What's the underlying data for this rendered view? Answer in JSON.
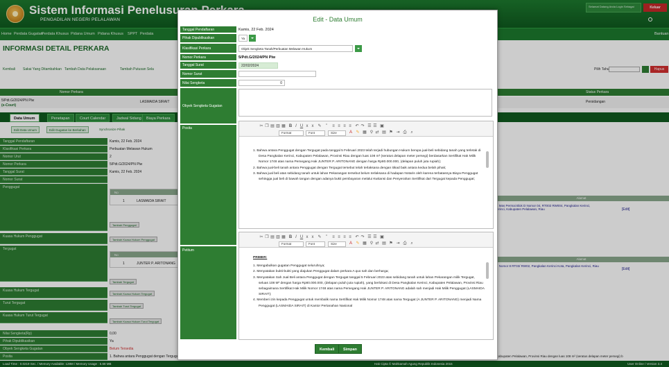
{
  "header": {
    "app_title": "Sistem Informasi Penelusuran Perkara",
    "app_subtitle": "PENGADILAN NEGERI PELALAWAN",
    "user_box": "Selamat Datang\nAnda Login Sebagai",
    "keluar": "Keluar",
    "bantuan": "Bantuan"
  },
  "nav": [
    "Home",
    "Perdata Gugatan",
    "Perdata Khusus",
    "Pidana Umum",
    "Pidana Khusus",
    "SPPT",
    "Perdata"
  ],
  "page": {
    "title": "INFORMASI DETAIL PERKARA",
    "toolbar": [
      "Kembali",
      "Sakai Yang Ditambahkan",
      "Tambah Data Pelaksanaan",
      "Tambah Putusan Sela"
    ],
    "pilih_tahun": "Pilih Tahun",
    "hapus": "Hapus",
    "grid_headers": [
      "Nomor Perkara",
      "Status Perkara"
    ],
    "grid_row": {
      "nomor": "5/Pdt.G/2024/PN Plw",
      "court": "(e-Court)",
      "pihak": "LASMAIDA SIRAIT",
      "status": "Persidangan"
    },
    "tabs": [
      "Data Umum",
      "Penetapan",
      "Court Calendar",
      "Jadwal Sidang",
      "Biaya Perkara"
    ],
    "sub_buttons": [
      "Edit Data Umum",
      "Edit Gugatan ke Berkahan",
      "Synchronize Pihak"
    ],
    "details": [
      {
        "label": "Tanggal Pendaftaran",
        "value": "Kamis, 22 Feb. 2024"
      },
      {
        "label": "Klasifikasi Perkara",
        "value": "Perbuatan Melawan Hukum"
      },
      {
        "label": "Nomor Urut",
        "value": "2"
      },
      {
        "label": "Nomor Perkara",
        "value": "5/Pdt.G/2024/PN Plw"
      },
      {
        "label": "Tanggal Surat",
        "value": "Kamis, 22 Feb. 2024"
      },
      {
        "label": "Nomor Surat",
        "value": ""
      },
      {
        "label": "Penggugat",
        "value": ""
      }
    ],
    "penggugat_row": {
      "no": "No",
      "idx": "1",
      "name": "LASMAIDA SIRAIT"
    },
    "tambah_penggugat": "Tambah Penggugat",
    "kuasa_hukum_penggugat": "Kuasa Hukum Penggugat",
    "tambah_kuasa_penggugat": "Tambah Kuasa Hukum Penggugat",
    "tergugat_label": "Tergugat",
    "tergugat_row": {
      "no": "No",
      "idx": "1",
      "name": "JUNTER P. ARITONANG"
    },
    "tambah_tergugat": "Tambah Tergugat",
    "kuasa_hukum_tergugat": "Kuasa Hukum Tergugat",
    "tambah_kuasa_tergugat": "Tambah Kuasa Hukum Tergugat",
    "turut_tergugat": "Turut Tergugat",
    "tambah_turut_tergugat": "Tambah Turut Tergugat",
    "kuasa_turut_tergugat": "Kuasa Hukum Turut Tergugat",
    "tambah_kuasa_turut": "Tambah Kuasa Hukum Turut Tergugat",
    "nilai_sengketa_label": "Nilai Sengketa(Rp)",
    "nilai_sengketa_value": "0,00",
    "pihak_dipublikasikan_label": "Pihak Dipublikasikan",
    "pihak_dipublikasikan_value": "Ya",
    "objek_sengketa_label": "Obyek Sengketa Gugatan",
    "objek_sengketa_value": "Belum Tersedia",
    "posita_label": "Posita",
    "posita_value": "1. Bahwa antara Penggugat dengan Tergugat pada tanggal 5 Februari 2023",
    "alamat_header": "Alamat",
    "alamat_penggugat": "Jl. Mas Permai Blok D Nomor 04, RT002 RW004, Pangkalan Kerinci, Kerinci, Kabupaten Pelalawan, Riau",
    "alamat_tergugat": "Jl. Nomor 8 RT03/ RW02, Pangkalan Kerinci Kota, Pangkalan Kerinci, Riau",
    "edit": "[Edit]",
    "bottom_text": "Kabupaten Pelalawan, Provinsi Riau dengan luas 108 m² (seratus delapan meter persegi) b"
  },
  "footer": {
    "left": "Load Time : 0.0219 Sec. / Memory Available: 128M / Memory Usage : 5.68 MB",
    "center": "Hak Cipta © Mahkamah Agung Republik Indonesia 2015",
    "right": "User Online / Version 3.4"
  },
  "modal": {
    "title": "Edit - Data Umum",
    "fields": {
      "tanggal_pendaftaran": {
        "label": "Tanggal Pendaftaran",
        "value": "Kamis, 22 Feb. 2024"
      },
      "pihak_dipublikasikan": {
        "label": "Pihak Dipublikasikan",
        "value": "Ya"
      },
      "klasifikasi_perkara": {
        "label": "Klasifikasi Perkara",
        "value": "Objek Sengketa Tanah/Perbuatan Melawan Hukum"
      },
      "nomor_perkara": {
        "label": "Nomor Perkara",
        "value": "5/Pdt.G/2024/PN Plw"
      },
      "tanggal_surat": {
        "label": "Tanggal Surat",
        "value": "22/02/2024"
      },
      "nomor_surat": {
        "label": "Nomor Surat",
        "value": ""
      },
      "nilai_sengketa": {
        "label": "Nilai Sengketa",
        "value": "0"
      },
      "obyek_sengketa": {
        "label": "Obyek Sengketa Gugatan",
        "value": ""
      },
      "posita": {
        "label": "Posita"
      },
      "petitum": {
        "label": "Petitum"
      }
    },
    "editor_toolbar": {
      "format": "Format",
      "font": "Font",
      "size": "Size"
    },
    "posita_paragraphs": [
      "1. Bahwa antara Penggugat dengan Tergugat pada tanggal 5 Februari 2023 telah terjadi hubungan Hukum berupa jual-beli sebidang tanah yang terletak di Desa Pangkalan Kerinci, Kabupaten Pelalawan, Provinsi Riau dengan luas 108 m² (seratus delapan meter persegi) berdasarkan Sertifikat Hak Milik Nomor 1748 atas nama Pemegang Hak JUNTER P. ARITONANG dengan harga Rp80.000.000, (delapan puluh juta rupiah);",
      "2. Bahwa jual-beli tanah antara Penggugat dengan Tergugat tersebut telah terlaksana dengan itikad baik antara kedua belah pihak;",
      "3. Bahwa jual beli atas sebidang tanah untuk lahan Pekarangan tersebut belum terlaksana di hadapan Notaris oleh karena terbatasnya Biaya Penggugat sehingga jual beli di bawah tangan dengan adanya bukti pembayaran melalui Kwitansi dan Penyerahan Sertifikat dari Tergugat kepada Penggugat;"
    ],
    "petitum_heading": "PRIMER:",
    "petitum_paragraphs": [
      "1. Mengabulkan gugatan Penggugat seluruhnya;",
      "2. Menyatakan bukti-bukti yang diajukan Penggugat dalam perkara A quo sah dan berharga;",
      "3. Menyatakan Sah Jual Beli antara Penggugat dengan Tergugat tanggal 5 Februari 2023 atas sebidang tanah untuk lahan Pekarangan milik Tergugat, seluas 108 M² dengan harga Rp80.000.000, (delapan puluh juta rupiah), yang berlokasi di Desa Pangkalan Kerinci, Kabupaten Pelalawan, Provinsi Riau sebagaimana Sertifikat Hak Milik Nomor 1748 atas nama Pemegang Hak JUNTER P. ARITONANG adalah sah menjadi Hak Milik Penggugat (LASMAIDA SIRAIT);",
      "4. Memberi izin kepada Penggugat untuk membalik nama Sertifikat Hak Milik Nomor 1748 atas nama Tergugat (A JUNTER P. ARITONANG) menjadi Nama Penggugat (LASMAIDA SIRAIT) di Kantor Pertanahan Nasional"
    ],
    "buttons": {
      "kembali": "Kembali",
      "simpan": "Simpan"
    }
  },
  "colors": {
    "primary_green": "#2e7d32",
    "dark_green": "#0f5a1f",
    "danger": "#d32f2f"
  }
}
